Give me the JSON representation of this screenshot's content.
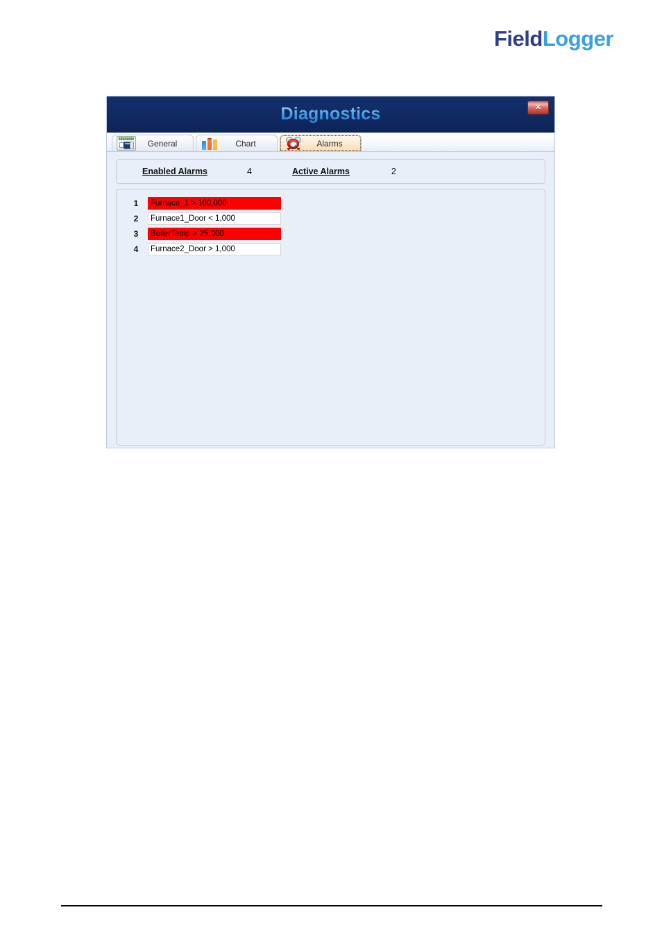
{
  "brand": {
    "name_part1": "Field",
    "name_part2": "Logger"
  },
  "window": {
    "title": "Diagnostics",
    "close_label": "✕",
    "close_icon": "close-icon"
  },
  "tabs": [
    {
      "label": "General",
      "icon": "device-icon",
      "active": false
    },
    {
      "label": "Chart",
      "icon": "bar-chart-icon",
      "active": false
    },
    {
      "label": "Alarms",
      "icon": "alarm-clock-icon",
      "active": true
    }
  ],
  "summary": {
    "enabled_label": "Enabled Alarms",
    "enabled_value": "4",
    "active_label": "Active Alarms",
    "active_value": "2"
  },
  "alarms": [
    {
      "index": "1",
      "text": "Furnace_1 > 100,000",
      "state": "active"
    },
    {
      "index": "2",
      "text": "Furnace1_Door < 1,000",
      "state": "inactive"
    },
    {
      "index": "3",
      "text": "BoilerTemp > 25,000",
      "state": "active"
    },
    {
      "index": "4",
      "text": "Furnace2_Door > 1,000",
      "state": "inactive"
    }
  ],
  "colors": {
    "title_bar": "#0e2a63",
    "title_text": "#4facf0",
    "alarm_active": "#ff0000",
    "alarm_inactive": "#ffffff",
    "body_background": "#e9eff9",
    "brand_dark": "#2e3f87",
    "brand_light": "#3aa0e0"
  }
}
